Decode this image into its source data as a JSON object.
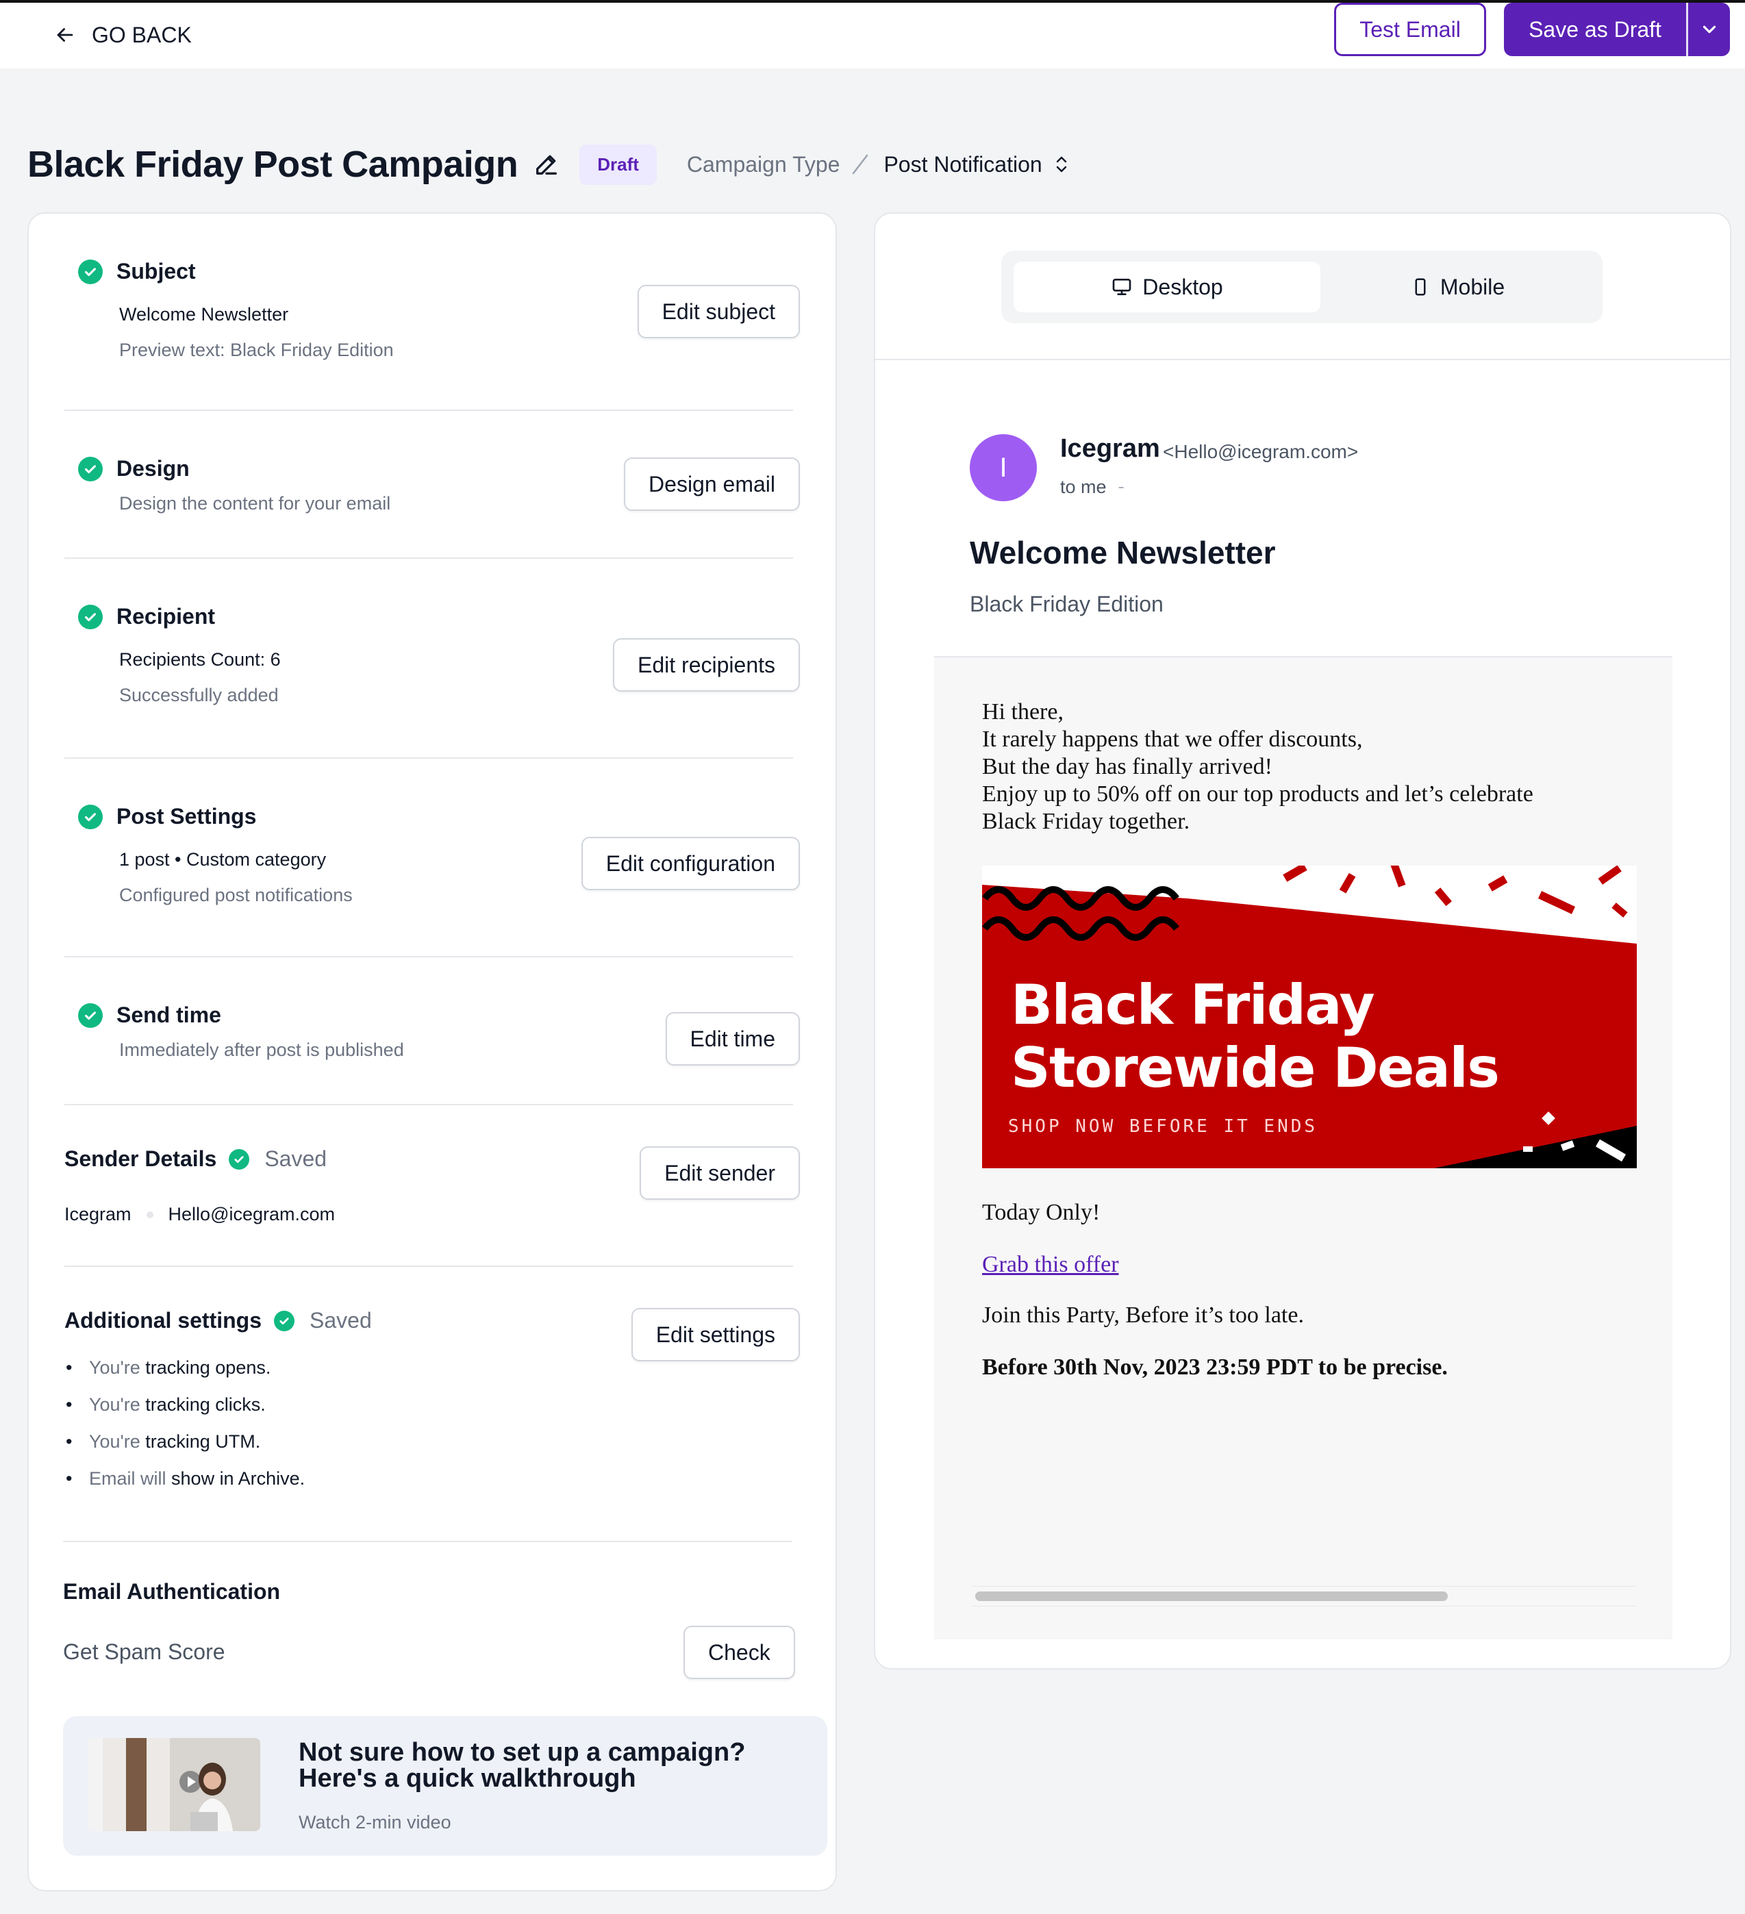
{
  "topbar": {
    "go_back": "GO BACK",
    "test_email": "Test Email",
    "save_draft": "Save as Draft"
  },
  "header": {
    "title": "Black Friday Post Campaign",
    "badge": "Draft",
    "campaign_type_label": "Campaign Type",
    "campaign_type_value": "Post Notification"
  },
  "steps": {
    "subject": {
      "title": "Subject",
      "line1": "Welcome Newsletter",
      "line2": "Preview text: Black Friday Edition",
      "button": "Edit subject"
    },
    "design": {
      "title": "Design",
      "line1": "Design the content for your email",
      "button": "Design email"
    },
    "recipient": {
      "title": "Recipient",
      "line1": "Recipients Count: 6",
      "line2": "Successfully added",
      "button": "Edit recipients"
    },
    "post_settings": {
      "title": "Post Settings",
      "line1": "1 post • Custom category",
      "line2": "Configured post notifications",
      "button": "Edit configuration"
    },
    "send_time": {
      "title": "Send time",
      "line1": "Immediately after post is published",
      "button": "Edit time"
    }
  },
  "sender": {
    "title": "Sender Details",
    "status": "Saved",
    "name": "Icegram",
    "email": "Hello@icegram.com",
    "button": "Edit sender"
  },
  "additional": {
    "title": "Additional settings",
    "status": "Saved",
    "button": "Edit settings",
    "items": [
      {
        "muted": "You're",
        "rest": "tracking opens."
      },
      {
        "muted": "You're",
        "rest": "tracking clicks."
      },
      {
        "muted": "You're",
        "rest": "tracking UTM."
      },
      {
        "muted": "Email will",
        "rest": "show in Archive."
      }
    ]
  },
  "auth": {
    "title": "Email Authentication",
    "label": "Get Spam Score",
    "button": "Check"
  },
  "promo": {
    "title": "Not sure how to set up a campaign? Here's a quick walkthrough",
    "subtitle": "Watch 2-min video"
  },
  "preview": {
    "tab_desktop": "Desktop",
    "tab_mobile": "Mobile",
    "avatar_letter": "I",
    "sender_name": "Icegram",
    "sender_email": "<Hello@icegram.com>",
    "to": "to me",
    "subject": "Welcome Newsletter",
    "preheader": "Black Friday Edition",
    "body_lines": [
      "Hi there,",
      "It rarely happens that we offer discounts,",
      "But the day has finally arrived!",
      "Enjoy up to 50% off on our top products and let’s celebrate",
      "Black Friday together."
    ],
    "banner_line1": "Black Friday",
    "banner_line2": "Storewide Deals",
    "banner_sub": "SHOP NOW BEFORE IT ENDS",
    "today": "Today Only!",
    "link": "Grab this offer",
    "join": "Join this Party, Before it’s too late.",
    "deadline": "Before 30th Nov, 2023 23:59 PDT to be precise."
  },
  "colors": {
    "accent": "#5b21b6",
    "success": "#10b981",
    "banner_red": "#c00000"
  }
}
